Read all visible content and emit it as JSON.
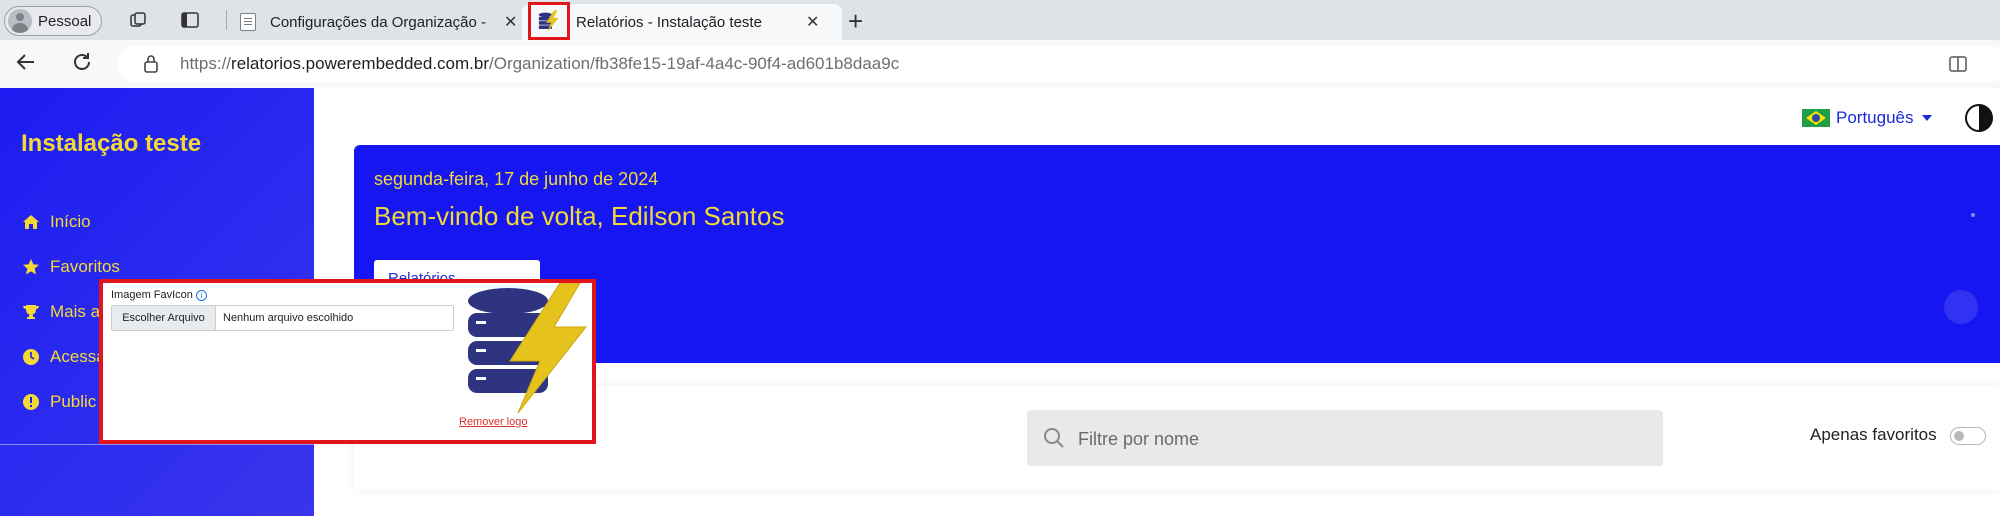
{
  "browser": {
    "profile": "Pessoal",
    "tabs": [
      {
        "title": "Configurações da Organização - ",
        "close": "✕"
      },
      {
        "title": "Relatórios - Instalação teste",
        "close": "✕"
      }
    ],
    "new_tab": "+",
    "url_prefix": "https://",
    "url_domain": "relatorios.powerembedded.com.br",
    "url_path": "/Organization/fb38fe15-19af-4a4c-90f4-ad601b8daa9c"
  },
  "sidebar": {
    "brand": "Instalação teste",
    "items": [
      {
        "label": "Início",
        "icon": "home-icon"
      },
      {
        "label": "Favoritos",
        "icon": "star-icon"
      },
      {
        "label": "Mais a",
        "icon": "trophy-icon"
      },
      {
        "label": "Acessa",
        "icon": "clock-icon"
      },
      {
        "label": "Public",
        "icon": "alert-icon"
      }
    ]
  },
  "header": {
    "language": "Português"
  },
  "hero": {
    "date": "segunda-feira, 17 de junho de 2024",
    "welcome": "Bem-vindo de volta, Edilson Santos",
    "tab_label": "Relatórios"
  },
  "filter": {
    "search_placeholder": "Filtre por nome",
    "favorites_only": "Apenas favoritos",
    "favorites_toggle_on": false
  },
  "overlay": {
    "label": "Imagem FavIcon",
    "choose_file": "Escolher Arquivo",
    "no_file": "Nenhum arquivo escolhido",
    "remove_logo": "Remover logo"
  },
  "colors": {
    "primary_blue": "#1616f2",
    "accent_yellow": "#f3d934",
    "highlight_red": "#e0161c"
  }
}
